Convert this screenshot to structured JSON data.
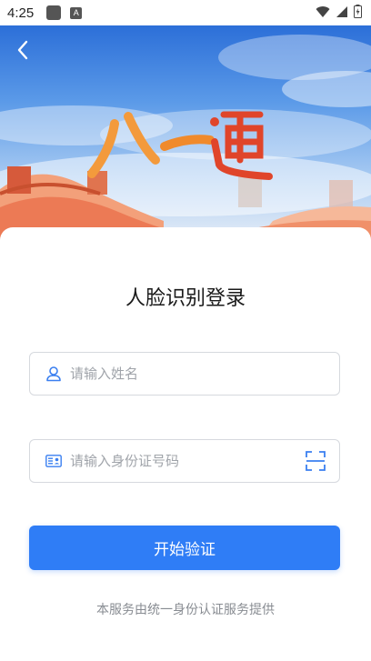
{
  "status_bar": {
    "time": "4:25",
    "notif_icon_label": "A"
  },
  "hero": {
    "title_text": "八一通"
  },
  "login": {
    "title": "人脸识别登录",
    "name_field": {
      "placeholder": "请输入姓名",
      "value": ""
    },
    "id_field": {
      "placeholder": "请输入身份证号码",
      "value": ""
    },
    "submit_label": "开始验证",
    "footer_text": "本服务由统一身份认证服务提供"
  },
  "colors": {
    "primary": "#2f7df6",
    "icon_blue": "#3a7ff0",
    "placeholder": "#a0a4aa"
  }
}
